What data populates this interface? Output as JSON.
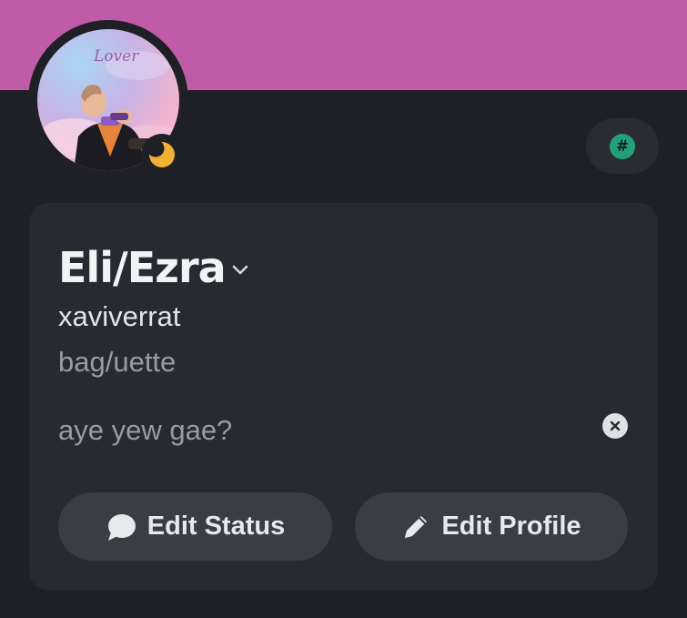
{
  "profile": {
    "display_name": "Eli/Ezra",
    "username": "xaviverrat",
    "pronouns": "bag/uette",
    "custom_status": "aye yew gae?",
    "avatar_text": "Lover",
    "presence": "idle"
  },
  "actions": {
    "edit_status_label": "Edit Status",
    "edit_profile_label": "Edit Profile"
  },
  "badge": {
    "symbol": "#"
  },
  "colors": {
    "banner": "#c05ca7",
    "background": "#1f2026",
    "card": "#282a32",
    "button": "#3b3d45",
    "idle": "#f0b232",
    "badge": "#23a07a"
  }
}
